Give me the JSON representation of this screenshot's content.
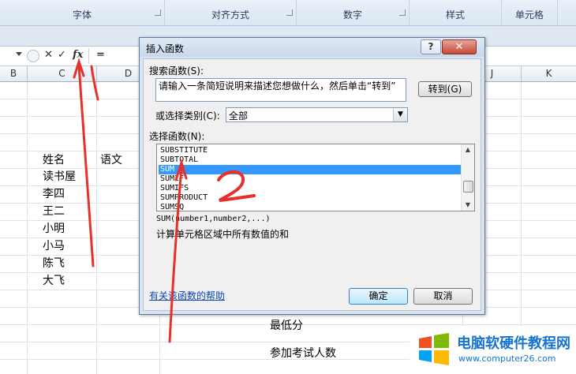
{
  "ribbon": {
    "groups": [
      "字体",
      "对齐方式",
      "数字",
      "样式",
      "单元格"
    ]
  },
  "formula_bar": {
    "cancel_glyph": "✕",
    "enter_glyph": "✓",
    "fx_label": "fx",
    "content": "="
  },
  "columns": [
    "B",
    "C",
    "D",
    "J",
    "K"
  ],
  "sheet": {
    "cells": [
      "姓名",
      "语文",
      "读书屋",
      "李四",
      "王二",
      "小明",
      "小马",
      "陈飞",
      "大飞",
      "最低分",
      "参加考试人数"
    ]
  },
  "dialog": {
    "title": "插入函数",
    "help_label": "?",
    "close_label": "✕",
    "search_label": "搜索函数(S):",
    "search_value": "请输入一条简短说明来描述您想做什么，然后单击“转到”",
    "goto_label": "转到(G)",
    "category_label": "或选择类别(C):",
    "category_value": "全部",
    "function_list_label": "选择函数(N):",
    "functions": [
      "SUBSTITUTE",
      "SUBTOTAL",
      "SUM",
      "SUMIF",
      "SUMIFS",
      "SUMPRODUCT",
      "SUMSQ"
    ],
    "selected_function": "SUM",
    "syntax": "SUM(number1,number2,...)",
    "description": "计算单元格区域中所有数值的和",
    "help_link": "有关该函数的帮助",
    "ok_label": "确定",
    "cancel_label": "取消"
  },
  "annotations": {
    "one": "1",
    "two": "2"
  },
  "watermark": {
    "title": "电脑软硬件教程网",
    "url": "www.computer26.com"
  },
  "colors": {
    "annotation": "#e8302a",
    "selection": "#3399ff",
    "link": "#0a47b3",
    "watermark": "#1673d0"
  }
}
